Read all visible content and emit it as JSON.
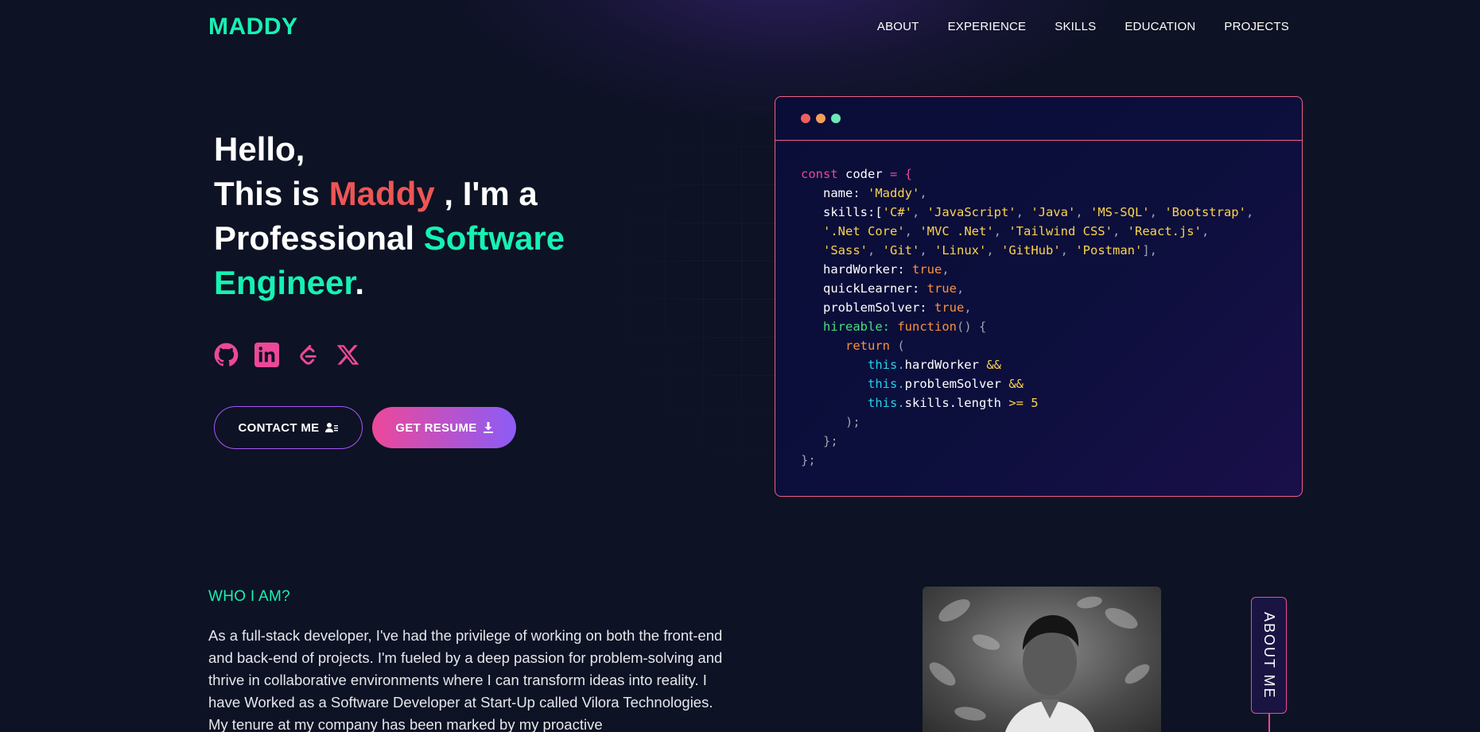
{
  "nav": {
    "logo": "MADDY",
    "links": [
      "ABOUT",
      "EXPERIENCE",
      "SKILLS",
      "EDUCATION",
      "PROJECTS"
    ]
  },
  "hero": {
    "greeting": "Hello,",
    "intro_prefix": "This is ",
    "name": "Maddy",
    "intro_suffix": " , I'm a",
    "role_prefix": "Professional ",
    "role": "Software Engineer",
    "period": ".",
    "socials": [
      "github-icon",
      "linkedin-icon",
      "leetcode-icon",
      "x-twitter-icon"
    ],
    "contact_label": "CONTACT ME",
    "resume_label": "GET RESUME"
  },
  "code": {
    "dots": [
      "#ef5f5f",
      "#f59e5b",
      "#6ee7b7"
    ],
    "lines": [
      [
        [
          "const ",
          "k-pink"
        ],
        [
          "coder ",
          "k-white"
        ],
        [
          "= {",
          "k-pink"
        ]
      ],
      [
        [
          "   name: ",
          "k-white"
        ],
        [
          "'Maddy'",
          "k-amber"
        ],
        [
          ",",
          "k-gray"
        ]
      ],
      [
        [
          "   skills:[",
          "k-white"
        ],
        [
          "'C#'",
          "k-amber"
        ],
        [
          ", ",
          "k-gray"
        ],
        [
          "'JavaScript'",
          "k-amber"
        ],
        [
          ", ",
          "k-gray"
        ],
        [
          "'Java'",
          "k-amber"
        ],
        [
          ", ",
          "k-gray"
        ],
        [
          "'MS-SQL'",
          "k-amber"
        ],
        [
          ", ",
          "k-gray"
        ],
        [
          "'Bootstrap'",
          "k-amber"
        ],
        [
          ",",
          "k-gray"
        ]
      ],
      [
        [
          "   ",
          "k-white"
        ],
        [
          "'.Net Core'",
          "k-amber"
        ],
        [
          ", ",
          "k-gray"
        ],
        [
          "'MVC .Net'",
          "k-amber"
        ],
        [
          ", ",
          "k-gray"
        ],
        [
          "'Tailwind CSS'",
          "k-amber"
        ],
        [
          ", ",
          "k-gray"
        ],
        [
          "'React.js'",
          "k-amber"
        ],
        [
          ",",
          "k-gray"
        ]
      ],
      [
        [
          "   ",
          "k-white"
        ],
        [
          "'Sass'",
          "k-amber"
        ],
        [
          ", ",
          "k-gray"
        ],
        [
          "'Git'",
          "k-amber"
        ],
        [
          ", ",
          "k-gray"
        ],
        [
          "'Linux'",
          "k-amber"
        ],
        [
          ", ",
          "k-gray"
        ],
        [
          "'GitHub'",
          "k-amber"
        ],
        [
          ", ",
          "k-gray"
        ],
        [
          "'Postman'",
          "k-amber"
        ],
        [
          "],",
          "k-gray"
        ]
      ],
      [
        [
          "   hardWorker: ",
          "k-white"
        ],
        [
          "true",
          "k-orange"
        ],
        [
          ",",
          "k-gray"
        ]
      ],
      [
        [
          "   quickLearner: ",
          "k-white"
        ],
        [
          "true",
          "k-orange"
        ],
        [
          ",",
          "k-gray"
        ]
      ],
      [
        [
          "   problemSolver: ",
          "k-white"
        ],
        [
          "true",
          "k-orange"
        ],
        [
          ",",
          "k-gray"
        ]
      ],
      [
        [
          "   hireable: ",
          "k-green"
        ],
        [
          "function",
          "k-orange"
        ],
        [
          "() {",
          "k-gray"
        ]
      ],
      [
        [
          "      return ",
          "k-orange"
        ],
        [
          "(",
          "k-gray"
        ]
      ],
      [
        [
          "         this.",
          "k-cyan"
        ],
        [
          "hardWorker ",
          "k-white"
        ],
        [
          "&&",
          "k-amber"
        ]
      ],
      [
        [
          "         this.",
          "k-cyan"
        ],
        [
          "problemSolver ",
          "k-white"
        ],
        [
          "&&",
          "k-amber"
        ]
      ],
      [
        [
          "         this.",
          "k-cyan"
        ],
        [
          "skills.length ",
          "k-white"
        ],
        [
          ">= 5",
          "k-amber"
        ]
      ],
      [
        [
          "      );",
          "k-gray"
        ]
      ],
      [
        [
          "   };",
          "k-gray"
        ]
      ],
      [
        [
          "};",
          "k-gray"
        ]
      ]
    ]
  },
  "about": {
    "title": "WHO I AM?",
    "text": "As a full-stack developer, I've had the privilege of working on both the front-end and back-end of projects. I'm fueled by a deep passion for problem-solving and thrive in collaborative environments where I can transform ideas into reality. I have Worked as a Software Developer at Start-Up called Vilora Technologies. My tenure at my company has been marked by my proactive",
    "tab_label": "ABOUT ME"
  },
  "colors": {
    "accent_green": "#16f2b3",
    "accent_pink": "#ec4899",
    "name_red": "#ec5656",
    "background": "#0d1224"
  }
}
